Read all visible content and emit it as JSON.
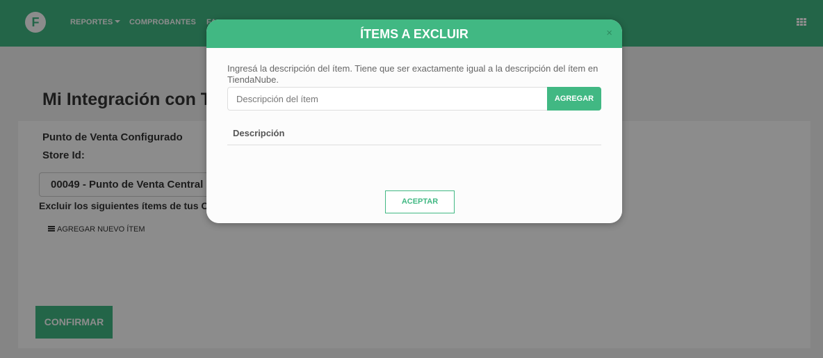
{
  "navbar": {
    "logo_letter": "F",
    "items": [
      {
        "label": "REPORTES"
      },
      {
        "label": "COMPROBANTES"
      },
      {
        "label": "FA"
      }
    ]
  },
  "page": {
    "title": "Mi Integración con Tie",
    "punto_label": "Punto de Venta Configurado",
    "store_label": "Store Id:",
    "punto_select_value": "00049 - Punto de Venta Central",
    "excluir_label": "Excluir los siguientes ítems de tus Co",
    "add_item_link": "AGREGAR NUEVO ÍTEM",
    "confirm_label": "CONFIRMAR"
  },
  "modal": {
    "title": "ÍTEMS A EXCLUIR",
    "close_glyph": "×",
    "help_text": "Ingresá la descripción del ítem. Tiene que ser exactamente igual a la descripción del ítem en TiendaNube.",
    "input_placeholder": "Descripción del ítem",
    "input_value": "",
    "agregar_label": "AGREGAR",
    "table_header": "Descripción",
    "aceptar_label": "ACEPTAR"
  },
  "colors": {
    "brand_green": "#41b883",
    "overlay": "rgba(0,0,0,0.45)"
  }
}
